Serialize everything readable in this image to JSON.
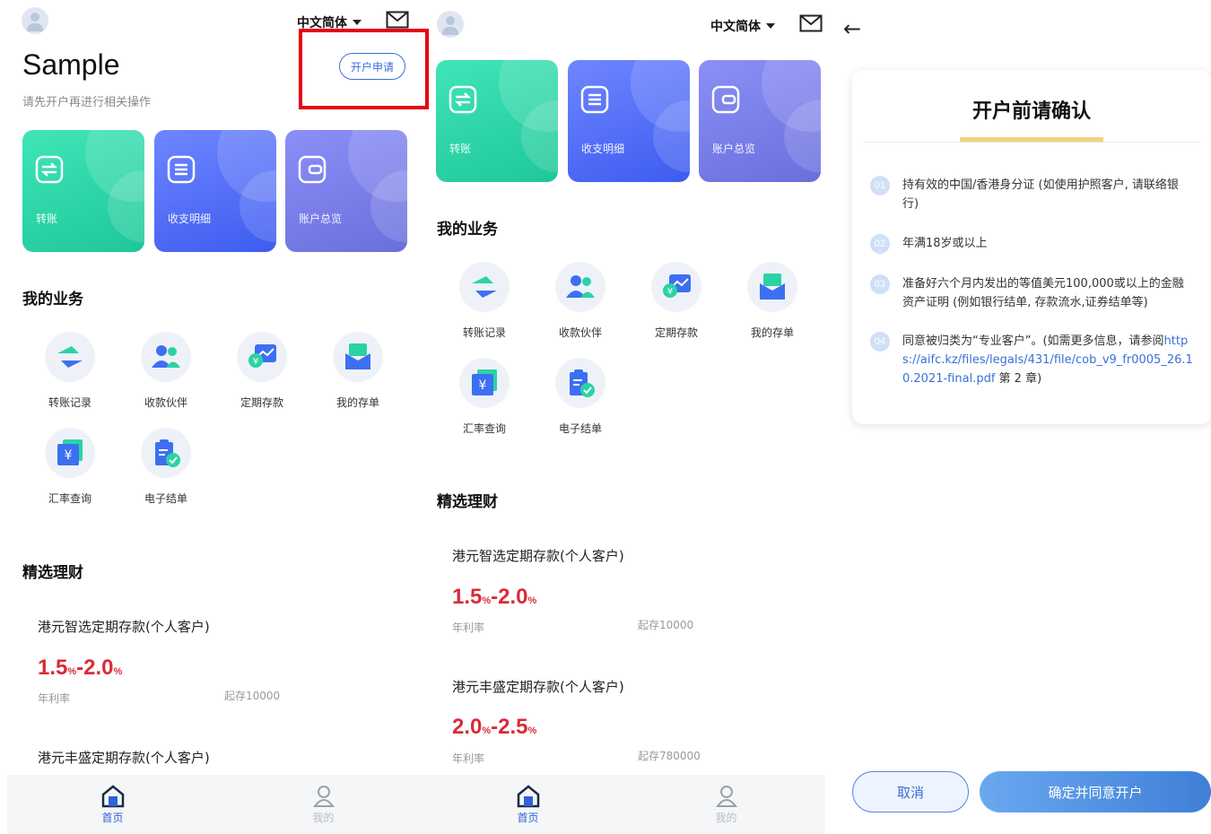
{
  "home": {
    "language": "中文简体",
    "brand": "Sample",
    "subtitle": "请先开户再进行相关操作",
    "apply_button": "开户申请",
    "quick_cards": [
      {
        "label": "转账",
        "icon": "transfer-card-icon",
        "color": "#2ad3a5"
      },
      {
        "label": "收支明细",
        "icon": "list-card-icon",
        "color": "#4f6ef7"
      },
      {
        "label": "账户总览",
        "icon": "wallet-card-icon",
        "color": "#7b80ea"
      }
    ],
    "business_title": "我的业务",
    "business_items": [
      {
        "label": "转账记录",
        "icon": "transfer-record-icon"
      },
      {
        "label": "收款伙伴",
        "icon": "payee-partners-icon"
      },
      {
        "label": "定期存款",
        "icon": "fixed-deposit-icon"
      },
      {
        "label": "我的存单",
        "icon": "my-deposit-icon"
      },
      {
        "label": "汇率查询",
        "icon": "exchange-rate-icon"
      },
      {
        "label": "电子结单",
        "icon": "e-statement-icon"
      }
    ],
    "finance_title": "精选理财",
    "products": [
      {
        "name": "港元智选定期存款(个人客户)",
        "rate_low": "1.5",
        "rate_high": "2.0",
        "percent": "%",
        "dash": "-",
        "rate_label": "年利率",
        "min_deposit": "起存10000"
      },
      {
        "name": "港元丰盛定期存款(个人客户)",
        "rate_low": "2.0",
        "rate_high": "2.5",
        "percent": "%",
        "dash": "-",
        "rate_label": "年利率",
        "min_deposit": "起存780000"
      }
    ],
    "tabs": [
      {
        "label": "首页",
        "icon": "home-icon"
      },
      {
        "label": "我的",
        "icon": "profile-icon"
      }
    ]
  },
  "confirm": {
    "title": "开户前请确认",
    "items": [
      {
        "num": "01",
        "text": "持有效的中国/香港身分证 (如使用护照客户, 请联络银行)"
      },
      {
        "num": "02",
        "text": "年满18岁或以上"
      },
      {
        "num": "03",
        "text": "准备好六个月内发出的等值美元100,000或以上的金融资产证明 (例如银行结单, 存款流水,证券结单等)"
      },
      {
        "num": "04",
        "text_before": "同意被归类为“专业客户”。(如需更多信息，请参阅",
        "link": "https://aifc.kz/files/legals/431/file/cob_v9_fr0005_26.10.2021-final.pdf",
        "text_after": " 第 2 章)"
      }
    ],
    "cancel_button": "取消",
    "ok_button": "确定并同意开户"
  },
  "colors": {
    "accent_blue": "#3a6fd8",
    "rate_red": "#d92b39",
    "highlight_red": "#e60012",
    "underline_gold": "#f3d27a"
  }
}
